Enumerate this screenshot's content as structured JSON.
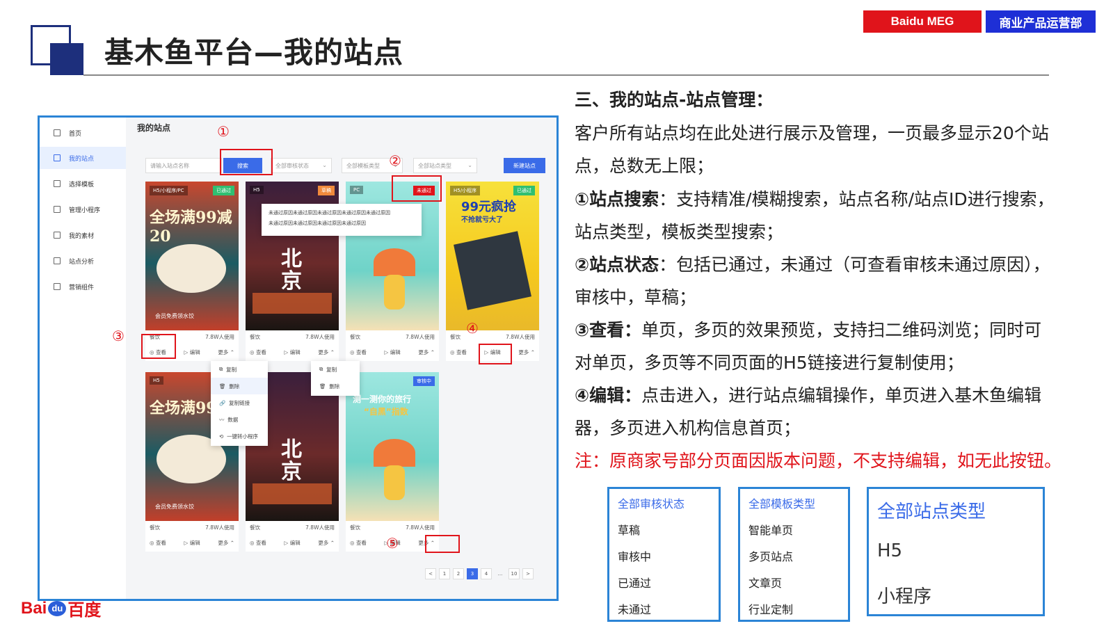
{
  "header": {
    "badge_meg": "Baidu MEG",
    "badge_dept": "商业产品运营部",
    "title": "基木鱼平台—我的站点"
  },
  "screenshot": {
    "sidebar": [
      {
        "label": "首页",
        "icon": "home-icon"
      },
      {
        "label": "我的站点",
        "icon": "monitor-icon",
        "active": true
      },
      {
        "label": "选择模板",
        "icon": "template-icon"
      },
      {
        "label": "管理小程序",
        "icon": "miniprogram-icon"
      },
      {
        "label": "我的素材",
        "icon": "image-icon"
      },
      {
        "label": "站点分析",
        "icon": "chart-icon"
      },
      {
        "label": "营销组件",
        "icon": "component-icon"
      }
    ],
    "page_title": "我的站点",
    "search_placeholder": "请输入站点名称",
    "search_button": "搜索",
    "filter_status": "全部审核状态",
    "filter_template": "全部模板类型",
    "filter_site": "全部站点类型",
    "new_button": "新建站点",
    "reject_popup_line1": "未通过原因未通过原因未通过原因未通过原因未通过原因",
    "reject_popup_line2": "未通过原因未通过原因未通过原因未通过原因",
    "cards_row1": [
      {
        "tag_l": "H5/小程序/PC",
        "tag_r": "已通过",
        "tag_color": "#2fbf71",
        "category": "餐饮",
        "usage": "7.8W人使用",
        "img_text": "全场满99减20",
        "sub_text": "会员免费领水饺"
      },
      {
        "tag_l": "H5",
        "tag_r": "草稿",
        "tag_color": "#f08a3c",
        "category": "餐饮",
        "usage": "7.8W人使用",
        "img_text": "北京"
      },
      {
        "tag_l": "PC",
        "tag_r": "未通过",
        "tag_color": "#e0141b",
        "category": "餐饮",
        "usage": "7.8W人使用",
        "img_text": ""
      },
      {
        "tag_l": "H5/小程序",
        "tag_r": "已通过",
        "tag_color": "#2fbf71",
        "category": "餐饮",
        "usage": "7.8W人使用",
        "img_text": "99元疯抢",
        "sub_text": "不抢就亏大了"
      }
    ],
    "cards_row2": [
      {
        "tag_l": "H5",
        "tag_r": "",
        "category": "餐饮",
        "usage": "7.8W人使用",
        "img_text": "全场满99",
        "sub_text": "会员免费领水饺"
      },
      {
        "tag_l": "",
        "tag_r": "",
        "category": "餐饮",
        "usage": "7.8W人使用",
        "img_text": "北京"
      },
      {
        "tag_l": "",
        "tag_r": "审核中",
        "tag_color": "#3a6be8",
        "category": "餐饮",
        "usage": "7.8W人使用",
        "img_text": "测一测你的旅行",
        "sub_text": "“自黑”指数"
      }
    ],
    "act_view": "查看",
    "act_edit": "编辑",
    "act_more": "更多",
    "more_menu": [
      "复制",
      "删除",
      "复制链接",
      "数据",
      "一键转小程序"
    ],
    "more_menu_short": [
      "复制",
      "删除"
    ],
    "pager": [
      "<",
      "1",
      "2",
      "3",
      "4",
      "...",
      "10",
      ">"
    ],
    "pager_active": "3",
    "markers": [
      "①",
      "②",
      "③",
      "④",
      "⑤"
    ]
  },
  "text": {
    "heading": "三、我的站点-站点管理：",
    "p1a": "客户所有站点均在此处进行展示及管理，一页最多显示20个站",
    "p1b": "点，总数无上限；",
    "s1_title": "①站点搜索",
    "s1a": "：支持精准/模糊搜索，站点名称/站点ID进行搜索，",
    "s1b": "站点类型，模板类型搜索；",
    "s2_title": "②站点状态",
    "s2a": "：包括已通过，未通过（可查看审核未通过原因），",
    "s2b": "审核中，草稿；",
    "s3_title": "③查看：",
    "s3a": "单页，多页的效果预览，支持扫二维码浏览；同时可",
    "s3b": "对单页，多页等不同页面的H5链接进行复制使用；",
    "s4_title": "④编辑：",
    "s4a": "点击进入，进行站点编辑操作，单页进入基木鱼编辑",
    "s4b": "器，多页进入机构信息首页；",
    "note": "注：原商家号部分页面因版本问题，不支持编辑，如无此按钮。"
  },
  "dropdowns": {
    "status": [
      "全部审核状态",
      "草稿",
      "审核中",
      "已通过",
      "未通过"
    ],
    "template": [
      "全部模板类型",
      "智能单页",
      "多页站点",
      "文章页",
      "行业定制"
    ],
    "site": [
      "全部站点类型",
      "H5",
      "小程序"
    ]
  },
  "footer_logo": {
    "left": "Bai",
    "mid": "du",
    "right": "百度"
  }
}
